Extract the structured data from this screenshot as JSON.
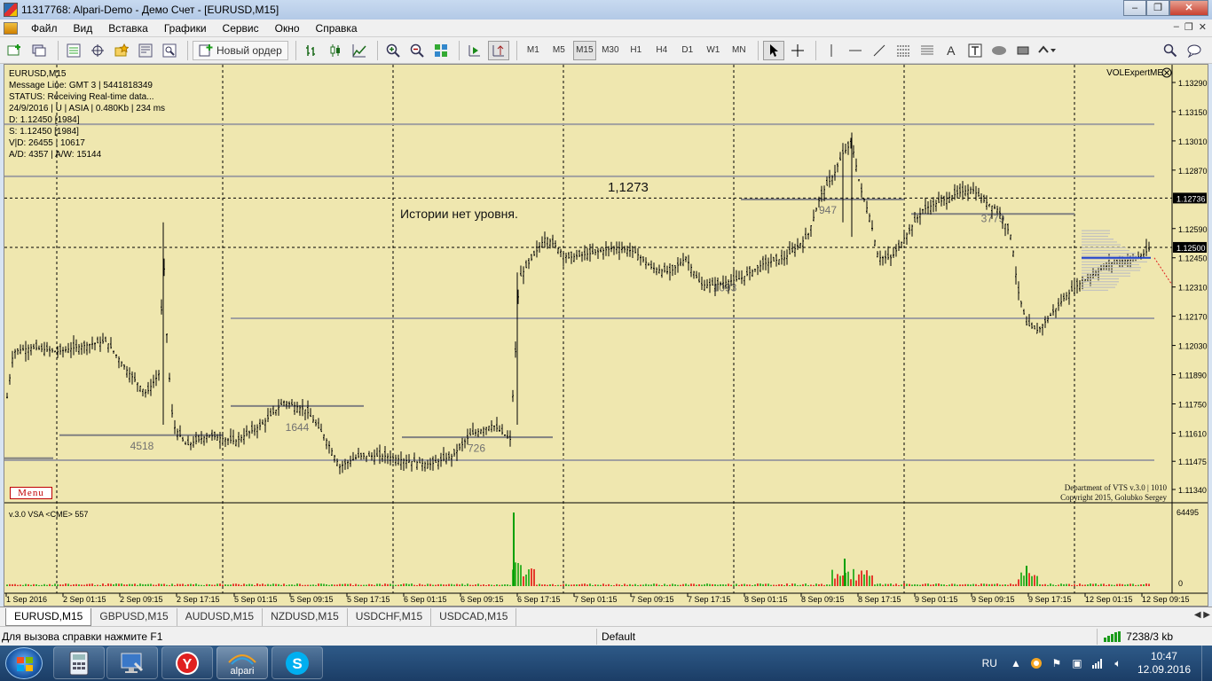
{
  "window": {
    "title": "11317768: Alpari-Demo - Демо Счет - [EURUSD,M15]",
    "buttons": [
      "–",
      "❐",
      "✕"
    ]
  },
  "menu": [
    "Файл",
    "Вид",
    "Вставка",
    "Графики",
    "Сервис",
    "Окно",
    "Справка"
  ],
  "toolbar": {
    "new_order_label": "Новый ордер",
    "timeframes": [
      "M1",
      "M5",
      "M15",
      "M30",
      "H1",
      "H4",
      "D1",
      "W1",
      "MN"
    ],
    "selected_timeframe": "M15"
  },
  "chart": {
    "info_lines": [
      "EURUSD,M15",
      "Message Line: GMT 3 | 5441818349",
      "STATUS:  Receiving Real-time data...",
      "24/9/2016 | U | ASIA | 0.480Kb | 234 ms",
      "D: 1.12450  [1984]",
      "S: 1.12450  [1984]",
      "V|D: 26455 | 10617",
      "A/D: 4357 | A/W: 15144"
    ],
    "expert_name": "VOLExpertME",
    "menu_button": "Menu",
    "annotation_level": "1,1273",
    "annotation_text": "Истории нет уровня.",
    "copyright_line1": "Department of VTS  v.3.0 | 1010",
    "copyright_line2": "Copyright 2015, Golubko Sergey",
    "subwindow_label": "v.3.0 VSA  <CME> 557",
    "subwindow_max": "64495",
    "subwindow_zero": "0",
    "price_labels": [
      "1.13290",
      "1.13150",
      "1.13010",
      "1.12870",
      "1.12590",
      "1.12450",
      "1.12310",
      "1.12170",
      "1.12030",
      "1.11890",
      "1.11750",
      "1.11610",
      "1.11475",
      "1.11340"
    ],
    "price_tags": [
      {
        "label": "1.12736",
        "price": 1.12736
      },
      {
        "label": "1.12500",
        "price": 1.125
      }
    ],
    "volume_level_labels": [
      {
        "text": "4518",
        "price": 1.1159
      },
      {
        "text": "1644",
        "price": 1.1168
      },
      {
        "text": "726",
        "price": 1.1158
      },
      {
        "text": "1093",
        "price": 1.1235
      },
      {
        "text": "947",
        "price": 1.1272
      },
      {
        "text": "3779",
        "price": 1.1268
      }
    ],
    "time_labels": [
      "1 Sep 2016",
      "2 Sep 01:15",
      "2 Sep 09:15",
      "2 Sep 17:15",
      "5 Sep 01:15",
      "5 Sep 09:15",
      "5 Sep 17:15",
      "6 Sep 01:15",
      "6 Sep 09:15",
      "6 Sep 17:15",
      "7 Sep 01:15",
      "7 Sep 09:15",
      "7 Sep 17:15",
      "8 Sep 01:15",
      "8 Sep 09:15",
      "8 Sep 17:15",
      "9 Sep 01:15",
      "9 Sep 09:15",
      "9 Sep 17:15",
      "12 Sep 01:15",
      "12 Sep 09:15"
    ]
  },
  "tabs": [
    "EURUSD,M15",
    "GBPUSD,M15",
    "AUDUSD,M15",
    "NZDUSD,M15",
    "USDCHF,M15",
    "USDCAD,M15"
  ],
  "active_tab": "EURUSD,M15",
  "status": {
    "help": "Для вызова справки нажмите F1",
    "profile": "Default",
    "traffic": "7238/3 kb"
  },
  "taskbar": {
    "apps": [
      "windows-explorer",
      "calculator",
      "remote-desktop",
      "yandex-browser",
      "alpari",
      "skype"
    ],
    "alpari_label": "alpari",
    "lang": "RU",
    "time": "10:47",
    "date": "12.09.2016"
  },
  "colors": {
    "chart_bg": "#efe7af",
    "candle": "#000000",
    "level_line": "#a0a0a0",
    "volume_bar_up": "#00a000",
    "volume_bar_down": "#e00000",
    "profile_bar": "#c0c0c0",
    "blue_line": "#2244cc"
  }
}
